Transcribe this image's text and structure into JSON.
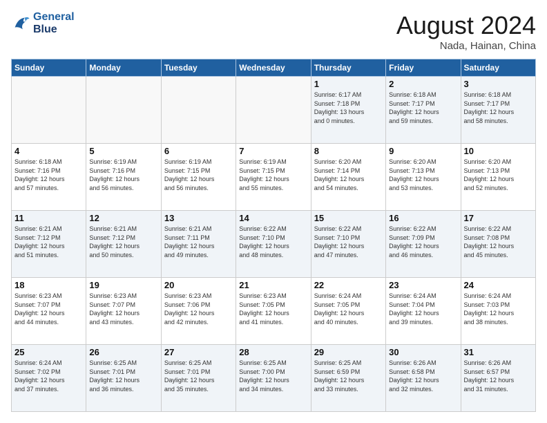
{
  "logo": {
    "line1": "General",
    "line2": "Blue"
  },
  "title": "August 2024",
  "subtitle": "Nada, Hainan, China",
  "days_of_week": [
    "Sunday",
    "Monday",
    "Tuesday",
    "Wednesday",
    "Thursday",
    "Friday",
    "Saturday"
  ],
  "weeks": [
    [
      {
        "day": "",
        "info": ""
      },
      {
        "day": "",
        "info": ""
      },
      {
        "day": "",
        "info": ""
      },
      {
        "day": "",
        "info": ""
      },
      {
        "day": "1",
        "info": "Sunrise: 6:17 AM\nSunset: 7:18 PM\nDaylight: 13 hours\nand 0 minutes."
      },
      {
        "day": "2",
        "info": "Sunrise: 6:18 AM\nSunset: 7:17 PM\nDaylight: 12 hours\nand 59 minutes."
      },
      {
        "day": "3",
        "info": "Sunrise: 6:18 AM\nSunset: 7:17 PM\nDaylight: 12 hours\nand 58 minutes."
      }
    ],
    [
      {
        "day": "4",
        "info": "Sunrise: 6:18 AM\nSunset: 7:16 PM\nDaylight: 12 hours\nand 57 minutes."
      },
      {
        "day": "5",
        "info": "Sunrise: 6:19 AM\nSunset: 7:16 PM\nDaylight: 12 hours\nand 56 minutes."
      },
      {
        "day": "6",
        "info": "Sunrise: 6:19 AM\nSunset: 7:15 PM\nDaylight: 12 hours\nand 56 minutes."
      },
      {
        "day": "7",
        "info": "Sunrise: 6:19 AM\nSunset: 7:15 PM\nDaylight: 12 hours\nand 55 minutes."
      },
      {
        "day": "8",
        "info": "Sunrise: 6:20 AM\nSunset: 7:14 PM\nDaylight: 12 hours\nand 54 minutes."
      },
      {
        "day": "9",
        "info": "Sunrise: 6:20 AM\nSunset: 7:13 PM\nDaylight: 12 hours\nand 53 minutes."
      },
      {
        "day": "10",
        "info": "Sunrise: 6:20 AM\nSunset: 7:13 PM\nDaylight: 12 hours\nand 52 minutes."
      }
    ],
    [
      {
        "day": "11",
        "info": "Sunrise: 6:21 AM\nSunset: 7:12 PM\nDaylight: 12 hours\nand 51 minutes."
      },
      {
        "day": "12",
        "info": "Sunrise: 6:21 AM\nSunset: 7:12 PM\nDaylight: 12 hours\nand 50 minutes."
      },
      {
        "day": "13",
        "info": "Sunrise: 6:21 AM\nSunset: 7:11 PM\nDaylight: 12 hours\nand 49 minutes."
      },
      {
        "day": "14",
        "info": "Sunrise: 6:22 AM\nSunset: 7:10 PM\nDaylight: 12 hours\nand 48 minutes."
      },
      {
        "day": "15",
        "info": "Sunrise: 6:22 AM\nSunset: 7:10 PM\nDaylight: 12 hours\nand 47 minutes."
      },
      {
        "day": "16",
        "info": "Sunrise: 6:22 AM\nSunset: 7:09 PM\nDaylight: 12 hours\nand 46 minutes."
      },
      {
        "day": "17",
        "info": "Sunrise: 6:22 AM\nSunset: 7:08 PM\nDaylight: 12 hours\nand 45 minutes."
      }
    ],
    [
      {
        "day": "18",
        "info": "Sunrise: 6:23 AM\nSunset: 7:07 PM\nDaylight: 12 hours\nand 44 minutes."
      },
      {
        "day": "19",
        "info": "Sunrise: 6:23 AM\nSunset: 7:07 PM\nDaylight: 12 hours\nand 43 minutes."
      },
      {
        "day": "20",
        "info": "Sunrise: 6:23 AM\nSunset: 7:06 PM\nDaylight: 12 hours\nand 42 minutes."
      },
      {
        "day": "21",
        "info": "Sunrise: 6:23 AM\nSunset: 7:05 PM\nDaylight: 12 hours\nand 41 minutes."
      },
      {
        "day": "22",
        "info": "Sunrise: 6:24 AM\nSunset: 7:05 PM\nDaylight: 12 hours\nand 40 minutes."
      },
      {
        "day": "23",
        "info": "Sunrise: 6:24 AM\nSunset: 7:04 PM\nDaylight: 12 hours\nand 39 minutes."
      },
      {
        "day": "24",
        "info": "Sunrise: 6:24 AM\nSunset: 7:03 PM\nDaylight: 12 hours\nand 38 minutes."
      }
    ],
    [
      {
        "day": "25",
        "info": "Sunrise: 6:24 AM\nSunset: 7:02 PM\nDaylight: 12 hours\nand 37 minutes."
      },
      {
        "day": "26",
        "info": "Sunrise: 6:25 AM\nSunset: 7:01 PM\nDaylight: 12 hours\nand 36 minutes."
      },
      {
        "day": "27",
        "info": "Sunrise: 6:25 AM\nSunset: 7:01 PM\nDaylight: 12 hours\nand 35 minutes."
      },
      {
        "day": "28",
        "info": "Sunrise: 6:25 AM\nSunset: 7:00 PM\nDaylight: 12 hours\nand 34 minutes."
      },
      {
        "day": "29",
        "info": "Sunrise: 6:25 AM\nSunset: 6:59 PM\nDaylight: 12 hours\nand 33 minutes."
      },
      {
        "day": "30",
        "info": "Sunrise: 6:26 AM\nSunset: 6:58 PM\nDaylight: 12 hours\nand 32 minutes."
      },
      {
        "day": "31",
        "info": "Sunrise: 6:26 AM\nSunset: 6:57 PM\nDaylight: 12 hours\nand 31 minutes."
      }
    ]
  ]
}
